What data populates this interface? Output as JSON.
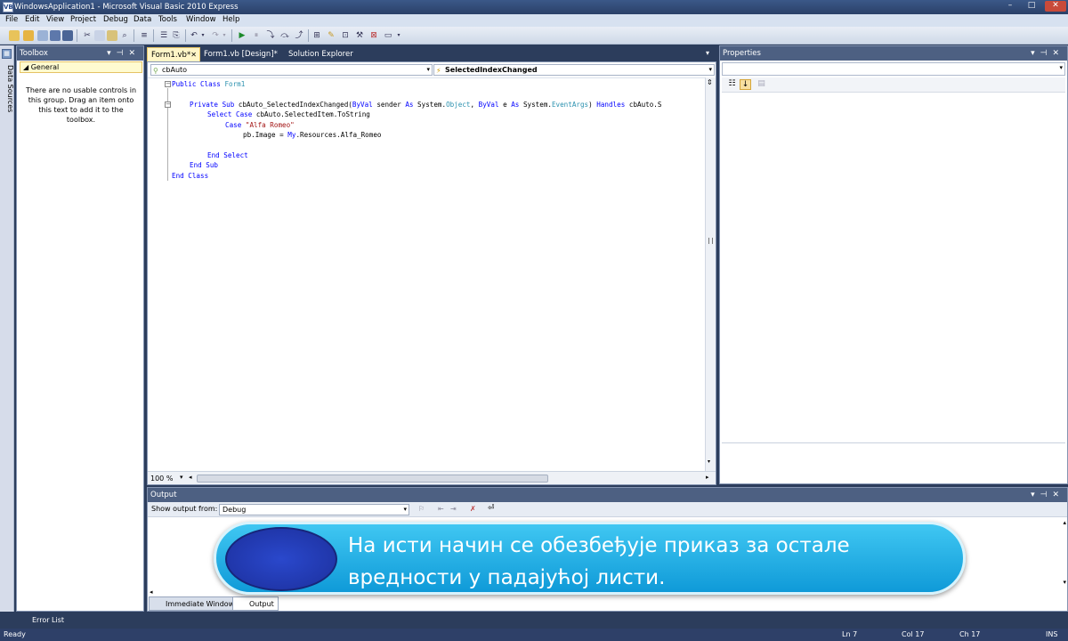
{
  "window": {
    "title": "WindowsApplication1 - Microsoft Visual Basic 2010 Express",
    "app_icon": "vb-icon"
  },
  "menu": [
    "File",
    "Edit",
    "View",
    "Project",
    "Debug",
    "Data",
    "Tools",
    "Window",
    "Help"
  ],
  "side_strip": {
    "label": "Data Sources"
  },
  "toolbox": {
    "title": "Toolbox",
    "group": "General",
    "empty_note": "There are no usable controls in this group. Drag an item onto this text to add it to the toolbox."
  },
  "tabs": [
    {
      "label": "Form1.vb*",
      "active": true
    },
    {
      "label": "Form1.vb [Design]*",
      "active": false
    },
    {
      "label": "Solution Explorer",
      "active": false
    }
  ],
  "editor": {
    "object_dropdown": "cbAuto",
    "event_dropdown": "SelectedIndexChanged",
    "code": {
      "l1_kw": "Public Class",
      "l1_name": " Form1",
      "l3_a": "Private Sub",
      "l3_b": " cbAuto_SelectedIndexChanged(",
      "l3_c": "ByVal",
      "l3_d": " sender ",
      "l3_e": "As",
      "l3_f": " System.",
      "l3_g": "Object",
      "l3_h": ", ",
      "l3_i": "ByVal",
      "l3_j": " e ",
      "l3_k": "As",
      "l3_l": " System.",
      "l3_m": "EventArgs",
      "l3_n": ") ",
      "l3_o": "Handles",
      "l3_p": " cbAuto.S",
      "l4_a": "Select Case",
      "l4_b": " cbAuto.SelectedItem.ToString",
      "l5_a": "Case",
      "l5_b": " \"Alfa Romeo\"",
      "l6_a": "pb.Image = ",
      "l6_b": "My",
      "l6_c": ".Resources.Alfa_Romeo",
      "l8": "End Select",
      "l9": "End Sub",
      "l10": "End Class"
    },
    "zoom": "100 %"
  },
  "properties": {
    "title": "Properties"
  },
  "output": {
    "title": "Output",
    "show_from_label": "Show output from:",
    "source": "Debug"
  },
  "bottom_tabs": [
    {
      "label": "Immediate Window",
      "active": false
    },
    {
      "label": "Output",
      "active": true
    }
  ],
  "error_list": "Error List",
  "status": {
    "ready": "Ready",
    "ln": "Ln 7",
    "col": "Col 17",
    "ch": "Ch 17",
    "mode": "INS"
  },
  "caption": {
    "line1": "На исти начин се обезбеђује приказ за остале",
    "line2": "вредности у падајућој листи."
  },
  "colors": {
    "accent": "#2b4a7e",
    "keyword": "#0000ff",
    "type": "#2b91af",
    "string": "#a31515",
    "caption_bg": "#1fb0e6"
  }
}
